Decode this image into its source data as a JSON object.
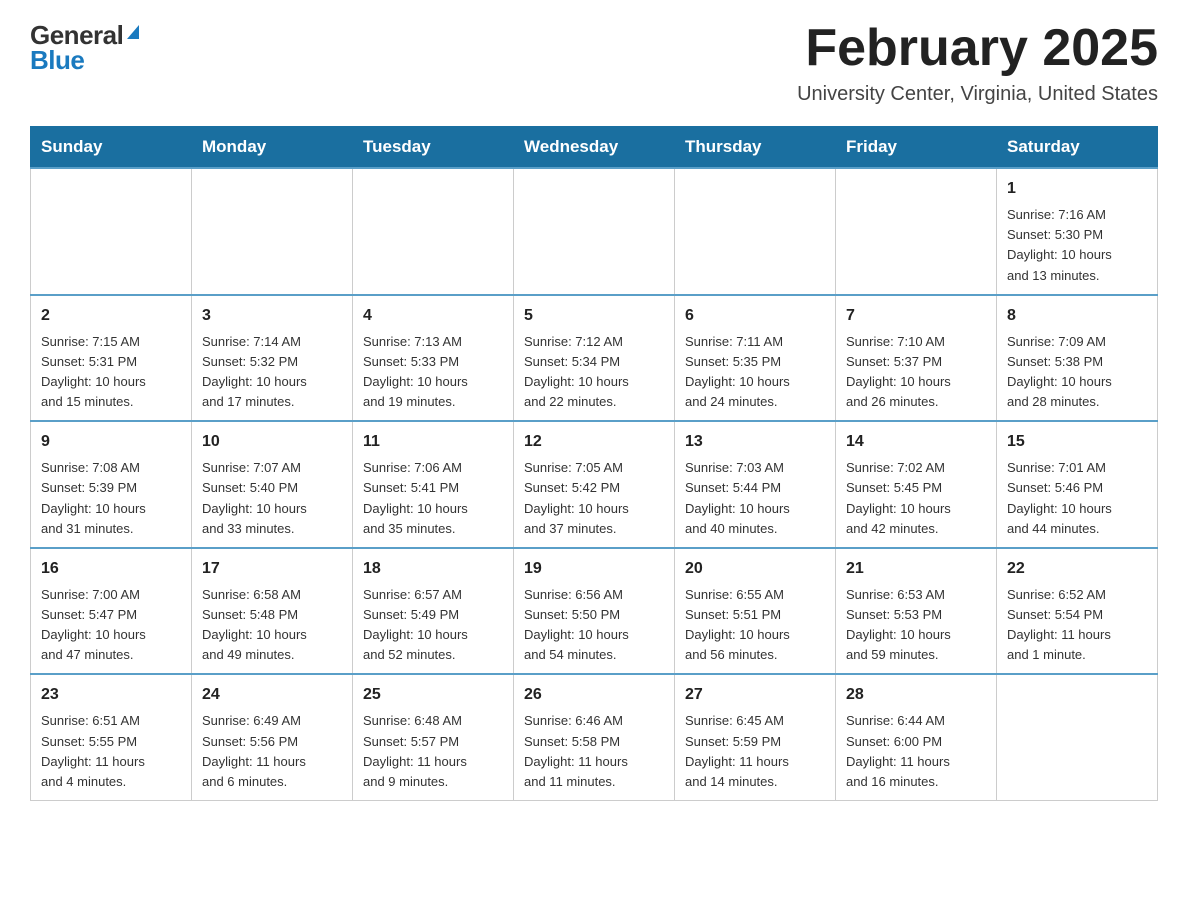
{
  "header": {
    "logo_general": "General",
    "logo_blue": "Blue",
    "title": "February 2025",
    "subtitle": "University Center, Virginia, United States"
  },
  "days_of_week": [
    "Sunday",
    "Monday",
    "Tuesday",
    "Wednesday",
    "Thursday",
    "Friday",
    "Saturday"
  ],
  "weeks": [
    [
      {
        "day": "",
        "info": ""
      },
      {
        "day": "",
        "info": ""
      },
      {
        "day": "",
        "info": ""
      },
      {
        "day": "",
        "info": ""
      },
      {
        "day": "",
        "info": ""
      },
      {
        "day": "",
        "info": ""
      },
      {
        "day": "1",
        "info": "Sunrise: 7:16 AM\nSunset: 5:30 PM\nDaylight: 10 hours\nand 13 minutes."
      }
    ],
    [
      {
        "day": "2",
        "info": "Sunrise: 7:15 AM\nSunset: 5:31 PM\nDaylight: 10 hours\nand 15 minutes."
      },
      {
        "day": "3",
        "info": "Sunrise: 7:14 AM\nSunset: 5:32 PM\nDaylight: 10 hours\nand 17 minutes."
      },
      {
        "day": "4",
        "info": "Sunrise: 7:13 AM\nSunset: 5:33 PM\nDaylight: 10 hours\nand 19 minutes."
      },
      {
        "day": "5",
        "info": "Sunrise: 7:12 AM\nSunset: 5:34 PM\nDaylight: 10 hours\nand 22 minutes."
      },
      {
        "day": "6",
        "info": "Sunrise: 7:11 AM\nSunset: 5:35 PM\nDaylight: 10 hours\nand 24 minutes."
      },
      {
        "day": "7",
        "info": "Sunrise: 7:10 AM\nSunset: 5:37 PM\nDaylight: 10 hours\nand 26 minutes."
      },
      {
        "day": "8",
        "info": "Sunrise: 7:09 AM\nSunset: 5:38 PM\nDaylight: 10 hours\nand 28 minutes."
      }
    ],
    [
      {
        "day": "9",
        "info": "Sunrise: 7:08 AM\nSunset: 5:39 PM\nDaylight: 10 hours\nand 31 minutes."
      },
      {
        "day": "10",
        "info": "Sunrise: 7:07 AM\nSunset: 5:40 PM\nDaylight: 10 hours\nand 33 minutes."
      },
      {
        "day": "11",
        "info": "Sunrise: 7:06 AM\nSunset: 5:41 PM\nDaylight: 10 hours\nand 35 minutes."
      },
      {
        "day": "12",
        "info": "Sunrise: 7:05 AM\nSunset: 5:42 PM\nDaylight: 10 hours\nand 37 minutes."
      },
      {
        "day": "13",
        "info": "Sunrise: 7:03 AM\nSunset: 5:44 PM\nDaylight: 10 hours\nand 40 minutes."
      },
      {
        "day": "14",
        "info": "Sunrise: 7:02 AM\nSunset: 5:45 PM\nDaylight: 10 hours\nand 42 minutes."
      },
      {
        "day": "15",
        "info": "Sunrise: 7:01 AM\nSunset: 5:46 PM\nDaylight: 10 hours\nand 44 minutes."
      }
    ],
    [
      {
        "day": "16",
        "info": "Sunrise: 7:00 AM\nSunset: 5:47 PM\nDaylight: 10 hours\nand 47 minutes."
      },
      {
        "day": "17",
        "info": "Sunrise: 6:58 AM\nSunset: 5:48 PM\nDaylight: 10 hours\nand 49 minutes."
      },
      {
        "day": "18",
        "info": "Sunrise: 6:57 AM\nSunset: 5:49 PM\nDaylight: 10 hours\nand 52 minutes."
      },
      {
        "day": "19",
        "info": "Sunrise: 6:56 AM\nSunset: 5:50 PM\nDaylight: 10 hours\nand 54 minutes."
      },
      {
        "day": "20",
        "info": "Sunrise: 6:55 AM\nSunset: 5:51 PM\nDaylight: 10 hours\nand 56 minutes."
      },
      {
        "day": "21",
        "info": "Sunrise: 6:53 AM\nSunset: 5:53 PM\nDaylight: 10 hours\nand 59 minutes."
      },
      {
        "day": "22",
        "info": "Sunrise: 6:52 AM\nSunset: 5:54 PM\nDaylight: 11 hours\nand 1 minute."
      }
    ],
    [
      {
        "day": "23",
        "info": "Sunrise: 6:51 AM\nSunset: 5:55 PM\nDaylight: 11 hours\nand 4 minutes."
      },
      {
        "day": "24",
        "info": "Sunrise: 6:49 AM\nSunset: 5:56 PM\nDaylight: 11 hours\nand 6 minutes."
      },
      {
        "day": "25",
        "info": "Sunrise: 6:48 AM\nSunset: 5:57 PM\nDaylight: 11 hours\nand 9 minutes."
      },
      {
        "day": "26",
        "info": "Sunrise: 6:46 AM\nSunset: 5:58 PM\nDaylight: 11 hours\nand 11 minutes."
      },
      {
        "day": "27",
        "info": "Sunrise: 6:45 AM\nSunset: 5:59 PM\nDaylight: 11 hours\nand 14 minutes."
      },
      {
        "day": "28",
        "info": "Sunrise: 6:44 AM\nSunset: 6:00 PM\nDaylight: 11 hours\nand 16 minutes."
      },
      {
        "day": "",
        "info": ""
      }
    ]
  ]
}
